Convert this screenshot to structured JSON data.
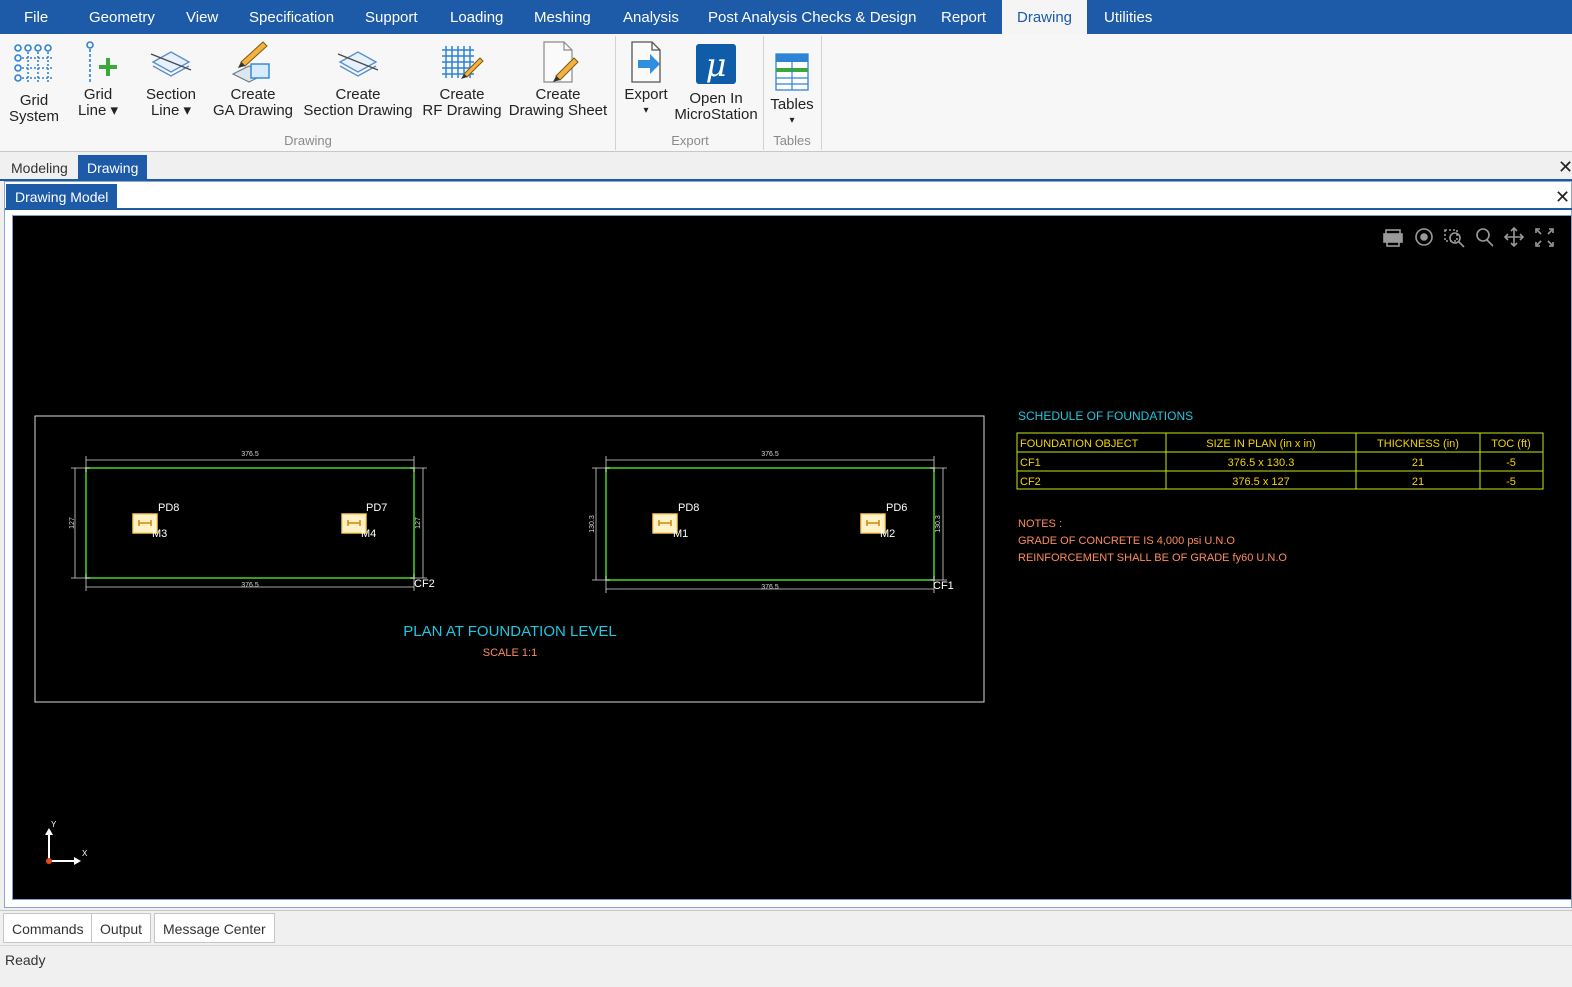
{
  "menubar": {
    "items": [
      "File",
      "Geometry",
      "View",
      "Specification",
      "Support",
      "Loading",
      "Meshing",
      "Analysis",
      "Post Analysis Checks & Design",
      "Report",
      "Drawing",
      "Utilities"
    ],
    "active": "Drawing",
    "color": "#1d5aa8"
  },
  "ribbon": {
    "drawing_group": {
      "label": "Drawing",
      "buttons": [
        {
          "line1": "Grid",
          "line2": "System",
          "icon": "grid-system-icon"
        },
        {
          "line1": "Grid",
          "line2": "Line ▾",
          "icon": "grid-line-icon"
        },
        {
          "line1": "Section",
          "line2": "Line ▾",
          "icon": "section-line-icon"
        },
        {
          "line1": "Create",
          "line2": "GA Drawing",
          "icon": "ga-drawing-icon"
        },
        {
          "line1": "Create",
          "line2": "Section Drawing",
          "icon": "section-drawing-icon"
        },
        {
          "line1": "Create",
          "line2": "RF Drawing",
          "icon": "rf-drawing-icon"
        },
        {
          "line1": "Create",
          "line2": "Drawing Sheet",
          "icon": "drawing-sheet-icon"
        }
      ]
    },
    "export_group": {
      "label": "Export",
      "buttons": [
        {
          "line1": "Export",
          "line2": "▾",
          "icon": "export-icon"
        },
        {
          "line1": "Open In",
          "line2": "MicroStation",
          "icon": "microstation-icon"
        }
      ]
    },
    "tables_group": {
      "label": "Tables",
      "buttons": [
        {
          "line1": "Tables",
          "line2": "▾",
          "icon": "tables-icon"
        }
      ]
    }
  },
  "doc_tabs": [
    "Modeling",
    "Drawing"
  ],
  "doc_tab_active": "Drawing",
  "inner_tab": "Drawing Model",
  "drawing": {
    "foundation_left": {
      "top_dim": "376.5",
      "bottom_dim": "376.5",
      "left_dim": "127",
      "right_dim": "127",
      "pedestals": [
        {
          "name": "PD8",
          "member": "M3"
        },
        {
          "name": "PD7",
          "member": "M4"
        }
      ],
      "label": "CF2"
    },
    "foundation_right": {
      "top_dim": "376.5",
      "bottom_dim": "376.5",
      "left_dim": "130.3",
      "right_dim": "130.3",
      "pedestals": [
        {
          "name": "PD8",
          "member": "M1"
        },
        {
          "name": "PD6",
          "member": "M2"
        }
      ],
      "label": "CF1"
    },
    "plan_title": "PLAN AT FOUNDATION LEVEL",
    "plan_scale": "SCALE 1:1",
    "schedule_title": "SCHEDULE OF FOUNDATIONS",
    "schedule_headers": [
      "FOUNDATION OBJECT",
      "SIZE IN PLAN (in  x  in)",
      "THICKNESS (in)",
      "TOC (ft)"
    ],
    "schedule_rows": [
      [
        "CF1",
        "376.5 x 130.3",
        "21",
        "-5"
      ],
      [
        "CF2",
        "376.5 x 127",
        "21",
        "-5"
      ]
    ],
    "notes_title": "NOTES :",
    "notes": [
      "GRADE OF CONCRETE IS 4,000 psi U.N.O",
      "REINFORCEMENT SHALL BE OF GRADE fy60 U.N.O"
    ],
    "axis_x": "X",
    "axis_y": "Y",
    "colors": {
      "background": "#000000",
      "footing": "#43c61e",
      "dims": "#d8d8d8",
      "title": "#1ec8e0",
      "scale": "#ff8c5a",
      "schedule_grid": "#c8e614",
      "schedule_text": "#f2d600",
      "pedestal": "#ffd15a"
    }
  },
  "bottom_tabs": [
    "Commands",
    "Output",
    "Message Center"
  ],
  "status_text": "Ready"
}
